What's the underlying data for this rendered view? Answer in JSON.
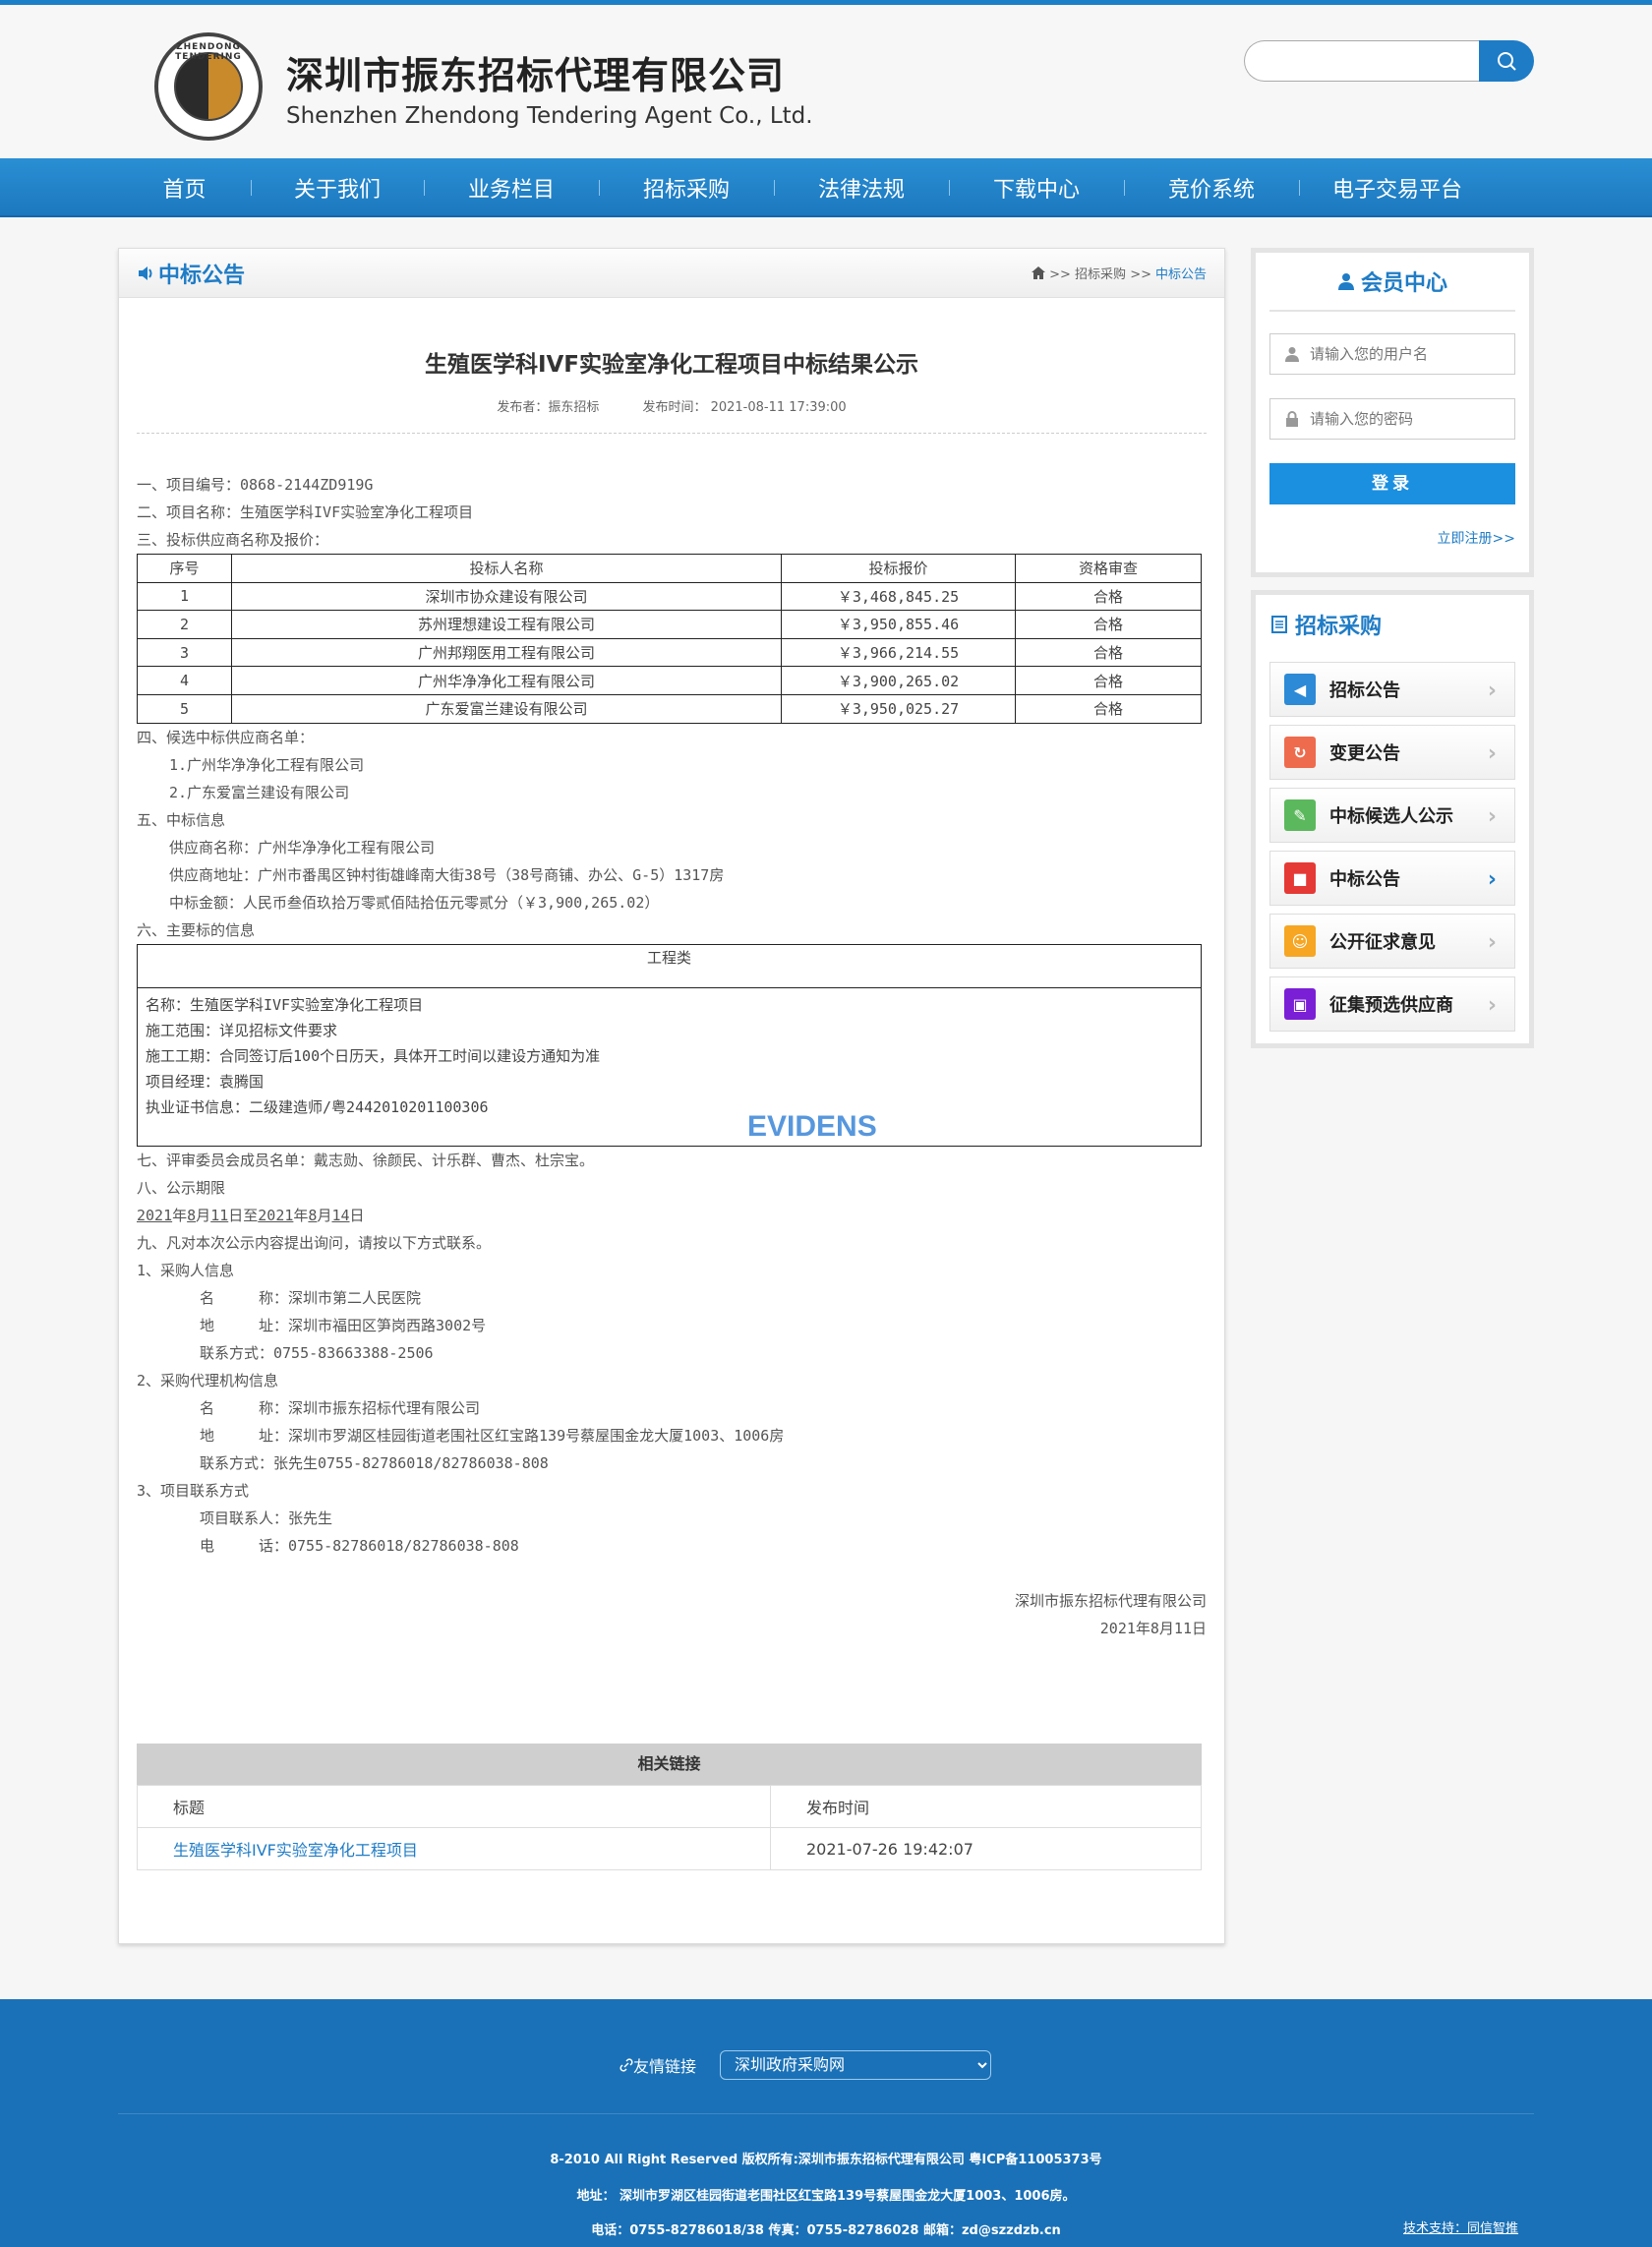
{
  "header": {
    "logo_text": "ZHENDONG TENDERING",
    "company_cn": "深圳市振东招标代理有限公司",
    "company_en": "Shenzhen Zhendong Tendering Agent Co., Ltd.",
    "search_placeholder": ""
  },
  "nav": [
    "首页",
    "关于我们",
    "业务栏目",
    "招标采购",
    "法律法规",
    "下载中心",
    "竞价系统",
    "电子交易平台"
  ],
  "section": {
    "title": "中标公告",
    "crumb_sep1": ">> 招标采购 >>",
    "crumb_current": "中标公告"
  },
  "article": {
    "title": "生殖医学科IVF实验室净化工程项目中标结果公示",
    "publisher": "发布者：振东招标",
    "publish_time": "发布时间： 2021-08-11 17:39:00",
    "l1": "一、项目编号：0868-2144ZD919G",
    "l2": "二、项目名称：生殖医学科IVF实验室净化工程项目",
    "l3": "三、投标供应商名称及报价：",
    "bid_headers": [
      "序号",
      "投标人名称",
      "投标报价",
      "资格审查"
    ],
    "bids": [
      {
        "no": "1",
        "name": "深圳市协众建设有限公司",
        "price": "￥3,468,845.25",
        "check": "合格"
      },
      {
        "no": "2",
        "name": "苏州理想建设工程有限公司",
        "price": "￥3,950,855.46",
        "check": "合格"
      },
      {
        "no": "3",
        "name": "广州邦翔医用工程有限公司",
        "price": "￥3,966,214.55",
        "check": "合格"
      },
      {
        "no": "4",
        "name": "广州华净净化工程有限公司",
        "price": "￥3,900,265.02",
        "check": "合格"
      },
      {
        "no": "5",
        "name": "广东爱富兰建设有限公司",
        "price": "￥3,950,025.27",
        "check": "合格"
      }
    ],
    "l4": "四、候选中标供应商名单：",
    "l4a": "1.广州华净净化工程有限公司",
    "l4b": "2.广东爱富兰建设有限公司",
    "l5": "五、中标信息",
    "l5a": "供应商名称：广州华净净化工程有限公司",
    "l5b": "供应商地址：广州市番禺区钟村街雄峰南大街38号（38号商铺、办公、G-5）1317房",
    "l5c": "中标金额：人民币叁佰玖拾万零贰佰陆拾伍元零贰分（￥3,900,265.02）",
    "l6": "六、主要标的信息",
    "box_head": "工程类",
    "box_lines": [
      "名称：生殖医学科IVF实验室净化工程项目",
      "施工范围：详见招标文件要求",
      "施工工期：合同签订后100个日历天，具体开工时间以建设方通知为准",
      "项目经理：袁腾国",
      "执业证书信息：二级建造师/粤2442010201100306"
    ],
    "watermark": "EVIDENS",
    "l7": "七、评审委员会成员名单：戴志勋、徐颜民、计乐群、曹杰、杜宗宝。",
    "l8": "八、公示期限",
    "period": {
      "y1": "2021",
      "a": "年",
      "m1": "8",
      "b": "月",
      "d1": "11",
      "c": "日至",
      "y2": "2021",
      "d": "年",
      "m2": "8",
      "e": "月",
      "d2": "14",
      "f": "日"
    },
    "l9": "九、凡对本次公示内容提出询问，请按以下方式联系。",
    "c1": "1、采购人信息",
    "c1a": "名　　　称：深圳市第二人民医院",
    "c1b": "地　　　址：深圳市福田区笋岗西路3002号",
    "c1c": "联系方式：0755-83663388-2506",
    "c2": "2、采购代理机构信息",
    "c2a": "名　　　称：深圳市振东招标代理有限公司",
    "c2b": "地　　　址：深圳市罗湖区桂园街道老围社区红宝路139号蔡屋围金龙大厦1003、1006房",
    "c2c": "联系方式：张先生0755-82786018/82786038-808",
    "c3": "3、项目联系方式",
    "c3a": "项目联系人：张先生",
    "c3b": "电　　　话：0755-82786018/82786038-808",
    "sign_company": "深圳市振东招标代理有限公司",
    "sign_date": "2021年8月11日"
  },
  "related": {
    "title": "相关链接",
    "col1": "标题",
    "col2": "发布时间",
    "rows": [
      {
        "title": "生殖医学科IVF实验室净化工程项目",
        "time": "2021-07-26 19:42:07"
      }
    ]
  },
  "member": {
    "title": "会员中心",
    "user_placeholder": "请输入您的用户名",
    "pass_placeholder": "请输入您的密码",
    "login": "登录",
    "register": "立即注册>>"
  },
  "purchase": {
    "title": "招标采购",
    "items": [
      {
        "label": "招标公告",
        "color": "#2d8ad6",
        "icon": "speaker-icon"
      },
      {
        "label": "变更公告",
        "color": "#ee6b4d",
        "icon": "refresh-icon"
      },
      {
        "label": "中标候选人公示",
        "color": "#5cb85c",
        "icon": "signature-icon"
      },
      {
        "label": "中标公告",
        "color": "#e53935",
        "icon": "stop-icon"
      },
      {
        "label": "公开征求意见",
        "color": "#f6a623",
        "icon": "group-icon"
      },
      {
        "label": "征集预选供应商",
        "color": "#7b1fd6",
        "icon": "inbox-icon"
      }
    ]
  },
  "footer": {
    "friend_links": "友情链接",
    "friend_selected": "深圳政府采购网",
    "copyright": "8-2010 All Right Reserved 版权所有:深圳市振东招标代理有限公司  粤ICP备11005373号",
    "address": "地址： 深圳市罗湖区桂园街道老围社区红宝路139号蔡屋围金龙大厦1003、1006房。",
    "contact": "电话：0755-82786018/38 传真：0755-82786028 邮箱：zd@szzdzb.cn",
    "tech": "技术支持：同信智推"
  }
}
